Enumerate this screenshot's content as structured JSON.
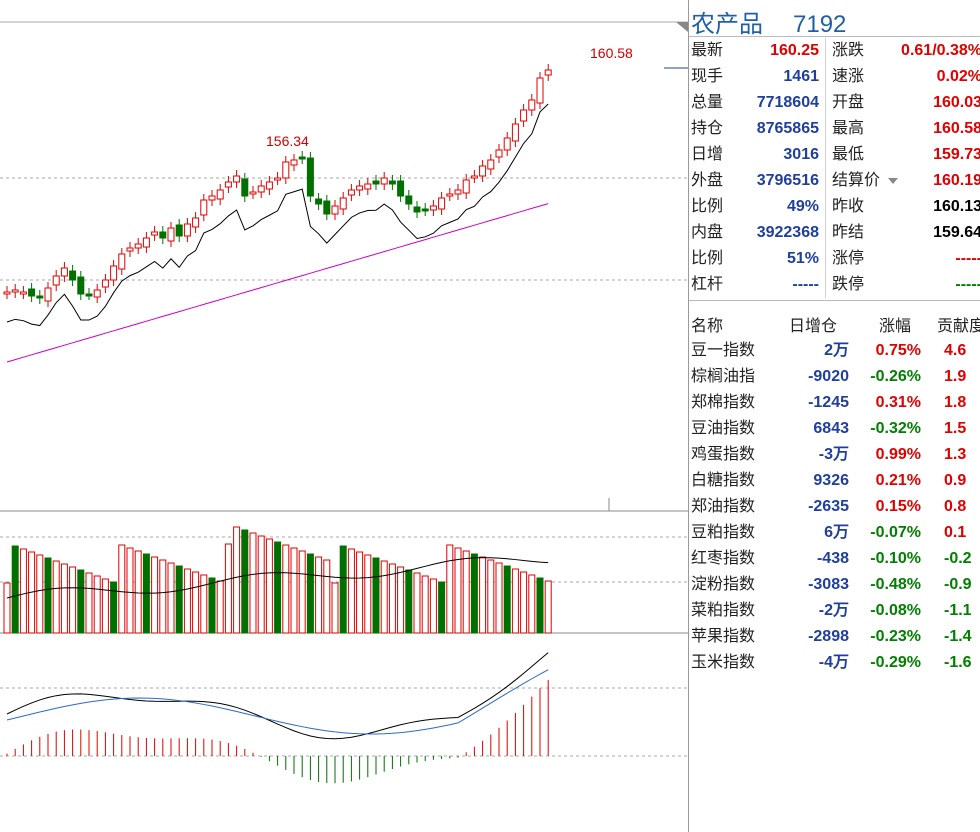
{
  "header": {
    "name": "农产品",
    "code": "7192"
  },
  "chart": {
    "high_label": "160.58",
    "peak_label": "156.34",
    "colors": {
      "up": "#e00000",
      "down": "#007000",
      "ma1": "#000000",
      "ma2": "#cc00cc",
      "dif": "#000000",
      "dea": "#2a6ad0"
    }
  },
  "quote": [
    {
      "l1": "最新",
      "v1": "160.25",
      "c1": "red",
      "l2": "涨跌",
      "v2": "0.61/0.38%",
      "c2": "red"
    },
    {
      "l1": "现手",
      "v1": "1461",
      "c1": "blue",
      "l2": "速涨",
      "v2": "0.02%",
      "c2": "red"
    },
    {
      "l1": "总量",
      "v1": "7718604",
      "c1": "blue",
      "l2": "开盘",
      "v2": "160.03",
      "c2": "red"
    },
    {
      "l1": "持仓",
      "v1": "8765865",
      "c1": "blue",
      "l2": "最高",
      "v2": "160.58",
      "c2": "red"
    },
    {
      "l1": "日增",
      "v1": "3016",
      "c1": "blue",
      "l2": "最低",
      "v2": "159.73",
      "c2": "red"
    },
    {
      "l1": "外盘",
      "v1": "3796516",
      "c1": "blue",
      "l2": "结算价",
      "v2": "160.19",
      "c2": "red"
    },
    {
      "l1": "比例",
      "v1": "49%",
      "c1": "blue",
      "l2": "昨收",
      "v2": "160.13",
      "c2": "black"
    },
    {
      "l1": "内盘",
      "v1": "3922368",
      "c1": "blue",
      "l2": "昨结",
      "v2": "159.64",
      "c2": "black"
    },
    {
      "l1": "比例",
      "v1": "51%",
      "c1": "blue",
      "l2": "涨停",
      "v2": "-----",
      "c2": "red"
    },
    {
      "l1": "杠杆",
      "v1": "-----",
      "c1": "blue",
      "l2": "跌停",
      "v2": "-----",
      "c2": "green"
    }
  ],
  "table": {
    "headers": {
      "name": "名称",
      "oi": "日增仓",
      "chg": "涨幅",
      "contrib": "贡献度"
    },
    "rows": [
      {
        "name": "豆一指数",
        "oi": "2万",
        "chg": "0.75%",
        "contrib": "4.6",
        "up": true
      },
      {
        "name": "棕榈油指",
        "oi": "-9020",
        "chg": "-0.26%",
        "contrib": "1.9",
        "up": false,
        "cup": true
      },
      {
        "name": "郑棉指数",
        "oi": "-1245",
        "chg": "0.31%",
        "contrib": "1.8",
        "up": true
      },
      {
        "name": "豆油指数",
        "oi": "6843",
        "chg": "-0.32%",
        "contrib": "1.5",
        "up": false,
        "cup": true
      },
      {
        "name": "鸡蛋指数",
        "oi": "-3万",
        "chg": "0.99%",
        "contrib": "1.3",
        "up": true
      },
      {
        "name": "白糖指数",
        "oi": "9326",
        "chg": "0.21%",
        "contrib": "0.9",
        "up": true
      },
      {
        "name": "郑油指数",
        "oi": "-2635",
        "chg": "0.15%",
        "contrib": "0.8",
        "up": true
      },
      {
        "name": "豆粕指数",
        "oi": "6万",
        "chg": "-0.07%",
        "contrib": "0.1",
        "up": false,
        "cup": true
      },
      {
        "name": "红枣指数",
        "oi": "-438",
        "chg": "-0.10%",
        "contrib": "-0.2",
        "up": false
      },
      {
        "name": "淀粉指数",
        "oi": "-3083",
        "chg": "-0.48%",
        "contrib": "-0.9",
        "up": false
      },
      {
        "name": "菜粕指数",
        "oi": "-2万",
        "chg": "-0.08%",
        "contrib": "-1.1",
        "up": false
      },
      {
        "name": "苹果指数",
        "oi": "-2898",
        "chg": "-0.23%",
        "contrib": "-1.4",
        "up": false
      },
      {
        "name": "玉米指数",
        "oi": "-4万",
        "chg": "-0.29%",
        "contrib": "-1.6",
        "up": false
      }
    ]
  }
}
